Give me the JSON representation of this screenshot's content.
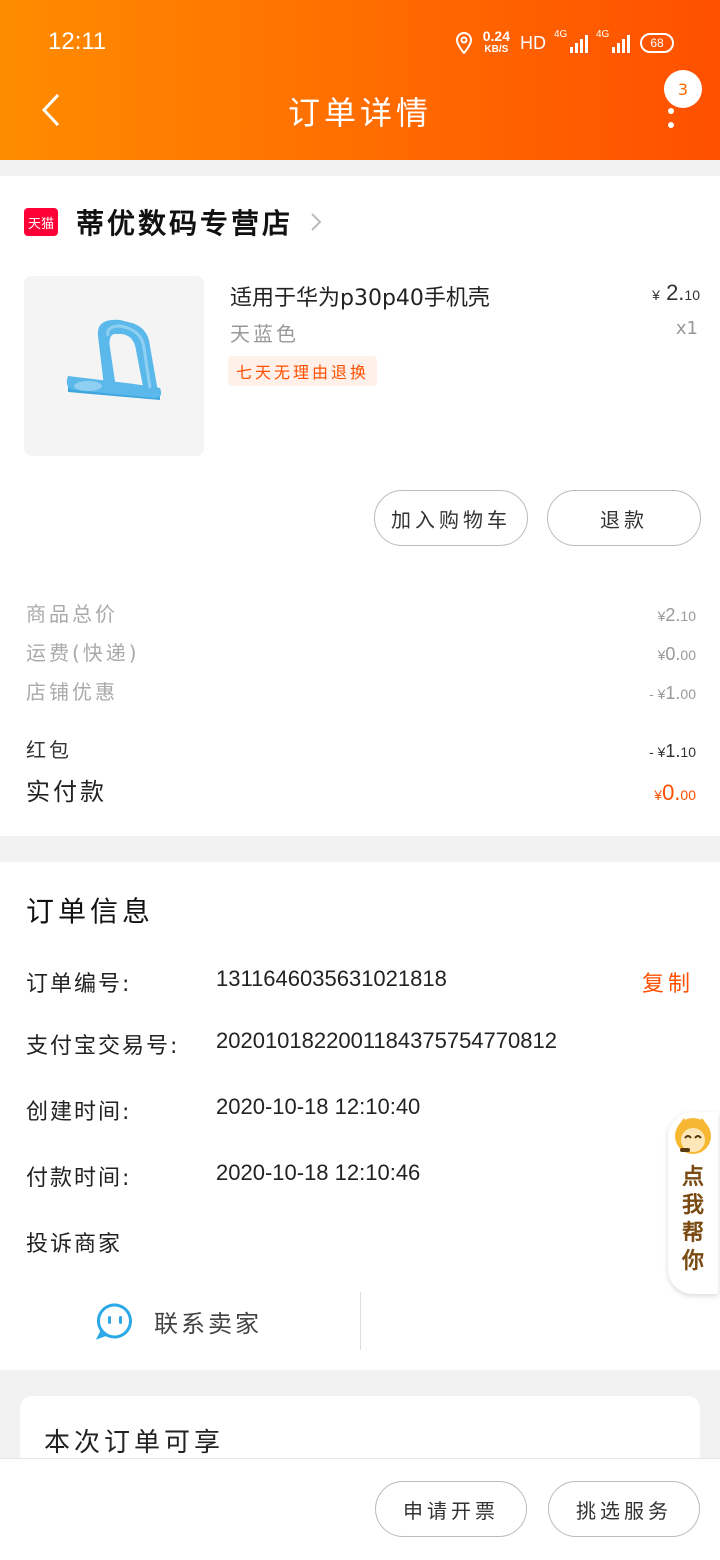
{
  "status_bar": {
    "time": "12:11",
    "net_speed": "0.24",
    "net_unit": "KB/S",
    "hd": "HD",
    "sim1": "4G",
    "sim2": "4G",
    "battery": "68"
  },
  "header": {
    "title": "订单详情",
    "notification_count": "3"
  },
  "store": {
    "badge": "天猫",
    "name": "蒂优数码专营店"
  },
  "product": {
    "name": "适用于华为p30p40手机壳",
    "price_symbol": "¥",
    "price_int": "2.",
    "price_dec": "10",
    "variant": "天蓝色",
    "quantity": "x1",
    "tag": "七天无理由退换",
    "image_color": "#5bb8ea"
  },
  "actions": {
    "add_to_cart": "加入购物车",
    "refund": "退款"
  },
  "summary": [
    {
      "label": "商品总价",
      "prefix": "¥",
      "int": "2.",
      "dec": "10"
    },
    {
      "label": "运费(快递)",
      "prefix": "¥",
      "int": "0.",
      "dec": "00"
    },
    {
      "label": "店铺优惠",
      "prefix": "- ¥",
      "int": "1.",
      "dec": "00"
    },
    {
      "label": "红包",
      "prefix": "- ¥",
      "int": "1.",
      "dec": "10"
    },
    {
      "label": "实付款",
      "prefix": "¥",
      "int": "0.",
      "dec": "00"
    }
  ],
  "order_info": {
    "title": "订单信息",
    "order_no_label": "订单编号:",
    "order_no": "1311646035631021818",
    "copy": "复制",
    "alipay_label": "支付宝交易号:",
    "alipay_no": "2020101822001184375754770812",
    "created_label": "创建时间:",
    "created": "2020-10-18 12:10:40",
    "paid_label": "付款时间:",
    "paid": "2020-10-18 12:10:46",
    "complain": "投诉商家",
    "contact": "联系卖家"
  },
  "benefits": {
    "title": "本次订单可享"
  },
  "bottom": {
    "invoice": "申请开票",
    "service": "挑选服务"
  },
  "helper": {
    "text": "点我帮你"
  },
  "colors": {
    "accent": "#ff5000",
    "header_start": "#ff8c00",
    "header_end": "#ff5000",
    "tmall_red": "#ff0036"
  }
}
